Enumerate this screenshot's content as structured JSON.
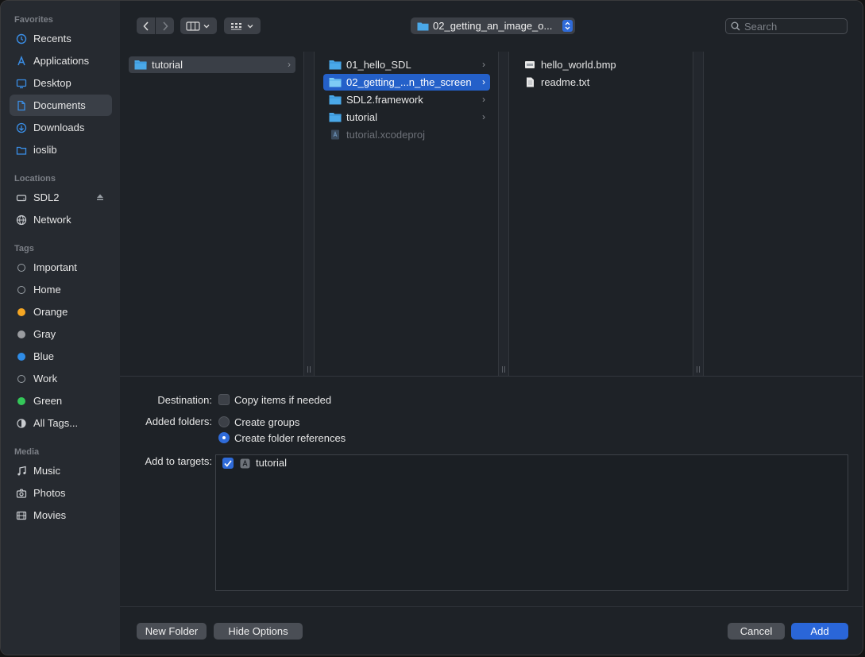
{
  "sidebar": {
    "favorites_header": "Favorites",
    "favorites": [
      {
        "label": "Recents",
        "icon": "clock-icon"
      },
      {
        "label": "Applications",
        "icon": "applications-icon"
      },
      {
        "label": "Desktop",
        "icon": "desktop-icon"
      },
      {
        "label": "Documents",
        "icon": "document-icon",
        "selected": true
      },
      {
        "label": "Downloads",
        "icon": "download-icon"
      },
      {
        "label": "ioslib",
        "icon": "folder-icon"
      }
    ],
    "locations_header": "Locations",
    "locations": [
      {
        "label": "SDL2",
        "icon": "drive-icon"
      },
      {
        "label": "Network",
        "icon": "globe-icon"
      }
    ],
    "tags_header": "Tags",
    "tags": [
      {
        "label": "Important",
        "color": ""
      },
      {
        "label": "Home",
        "color": ""
      },
      {
        "label": "Orange",
        "color": "#f5a623"
      },
      {
        "label": "Gray",
        "color": "#9a9ca0"
      },
      {
        "label": "Blue",
        "color": "#2f8ce6"
      },
      {
        "label": "Work",
        "color": ""
      },
      {
        "label": "Green",
        "color": "#34c759"
      },
      {
        "label": "All Tags...",
        "color": "all"
      }
    ],
    "media_header": "Media",
    "media": [
      {
        "label": "Music",
        "icon": "music-note-icon"
      },
      {
        "label": "Photos",
        "icon": "camera-icon"
      },
      {
        "label": "Movies",
        "icon": "film-icon"
      }
    ]
  },
  "toolbar": {
    "path_label": "02_getting_an_image_o...",
    "search_placeholder": "Search"
  },
  "browser": {
    "col1": [
      {
        "label": "tutorial",
        "type": "folder",
        "selected": "gray"
      }
    ],
    "col2": [
      {
        "label": "01_hello_SDL",
        "type": "folder"
      },
      {
        "label": "02_getting_...n_the_screen",
        "type": "folder",
        "selected": "blue"
      },
      {
        "label": "SDL2.framework",
        "type": "folder"
      },
      {
        "label": "tutorial",
        "type": "folder"
      },
      {
        "label": "tutorial.xcodeproj",
        "type": "xcodeproj",
        "dim": true
      }
    ],
    "col3": [
      {
        "label": "hello_world.bmp",
        "type": "image"
      },
      {
        "label": "readme.txt",
        "type": "text"
      }
    ]
  },
  "options": {
    "destination_label": "Destination:",
    "copy_items_label": "Copy items if needed",
    "copy_items_checked": false,
    "added_folders_label": "Added folders:",
    "create_groups_label": "Create groups",
    "create_folder_refs_label": "Create folder references",
    "added_folders_selected": "create_folder_references",
    "add_to_targets_label": "Add to targets:",
    "targets": [
      {
        "label": "tutorial",
        "checked": true
      }
    ]
  },
  "buttons": {
    "new_folder": "New Folder",
    "hide_options": "Hide Options",
    "cancel": "Cancel",
    "add": "Add"
  },
  "colors": {
    "accent": "#2a66d8",
    "folder": "#4aa8e8"
  }
}
